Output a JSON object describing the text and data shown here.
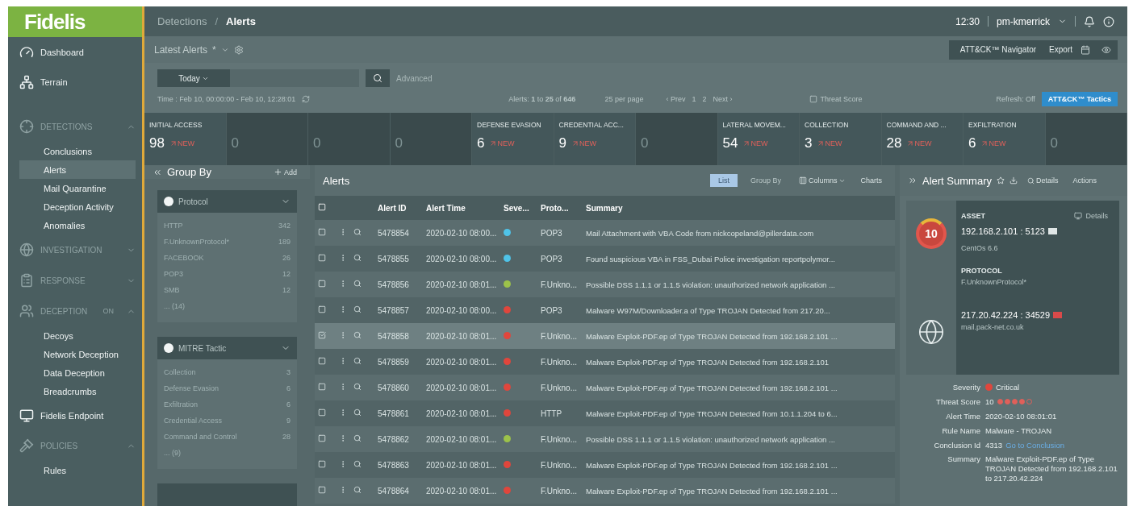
{
  "logo": "Fidelis",
  "nav": [
    {
      "kind": "link",
      "label": "Dashboard"
    },
    {
      "kind": "link",
      "label": "Terrain"
    },
    {
      "kind": "section",
      "label": "DETECTIONS",
      "expanded": true,
      "children": [
        {
          "label": "Conclusions",
          "selected": false
        },
        {
          "label": "Alerts",
          "selected": true
        },
        {
          "label": "Mail Quarantine",
          "selected": false
        },
        {
          "label": "Deception Activity",
          "selected": false
        },
        {
          "label": "Anomalies",
          "selected": false
        }
      ]
    },
    {
      "kind": "section",
      "label": "INVESTIGATION",
      "expanded": false
    },
    {
      "kind": "section",
      "label": "RESPONSE",
      "expanded": false
    },
    {
      "kind": "section",
      "label": "DECEPTION",
      "badge": "ON",
      "expanded": true,
      "children": [
        {
          "label": "Decoys",
          "selected": false
        },
        {
          "label": "Network Deception",
          "selected": false
        },
        {
          "label": "Data Deception",
          "selected": false
        },
        {
          "label": "Breadcrumbs",
          "selected": false
        }
      ]
    },
    {
      "kind": "link",
      "label": "Fidelis Endpoint"
    },
    {
      "kind": "section",
      "label": "POLICIES",
      "expanded": true,
      "children": [
        {
          "label": "Rules",
          "selected": false
        }
      ]
    }
  ],
  "breadcrumb": [
    "Detections",
    "Alerts"
  ],
  "breadcrumb_separator": "/",
  "clock": "12:30",
  "user": "pm-kmerrick",
  "view": {
    "title": "Latest Alerts",
    "modified": "*",
    "actions": [
      "ATT&CK™ Navigator",
      "Export"
    ]
  },
  "search": {
    "range": "Today",
    "advanced": "Advanced"
  },
  "time_range": "Time : Feb 10, 00:00:00 - Feb 10, 12:28:01",
  "count": "Alerts: **1** to **25** of **646**",
  "per_page": "25 per page",
  "pager": [
    "‹ Prev",
    "1",
    "2",
    "Next ›"
  ],
  "threat_score": {
    "label": "Threat Score",
    "checked": false
  },
  "refresh": "Refresh: Off",
  "tactics_button": "ATT&CK™ Tactics",
  "tiles": [
    {
      "label": "INITIAL ACCESS",
      "count": "98",
      "new": "NEW"
    },
    {
      "count": "0"
    },
    {
      "count": "0"
    },
    {
      "count": "0"
    },
    {
      "label": "DEFENSE EVASION",
      "count": "6",
      "new": "NEW"
    },
    {
      "label": "CREDENTIAL ACC...",
      "count": "9",
      "new": "NEW"
    },
    {
      "count": "0"
    },
    {
      "label": "LATERAL MOVEM...",
      "count": "54",
      "new": "NEW"
    },
    {
      "label": "COLLECTION",
      "count": "3",
      "new": "NEW"
    },
    {
      "label": "COMMAND AND ...",
      "count": "28",
      "new": "NEW"
    },
    {
      "label": "EXFILTRATION",
      "count": "6",
      "new": "NEW"
    },
    {
      "count": "0"
    }
  ],
  "group_by": {
    "title": "Group By",
    "add": "Add",
    "groups": [
      {
        "name": "Protocol",
        "expanded": true,
        "items": [
          {
            "label": "HTTP",
            "count": "342"
          },
          {
            "label": "F.UnknownProtocol*",
            "count": "189"
          },
          {
            "label": "FACEBOOK",
            "count": "26"
          },
          {
            "label": "POP3",
            "count": "12"
          },
          {
            "label": "SMB",
            "count": "12"
          }
        ],
        "more": "... (14)"
      },
      {
        "name": "MITRE Tactic",
        "expanded": true,
        "items": [
          {
            "label": "Collection",
            "count": "3"
          },
          {
            "label": "Defense Evasion",
            "count": "6"
          },
          {
            "label": "Exfiltration",
            "count": "6"
          },
          {
            "label": "Credential Access",
            "count": "9"
          },
          {
            "label": "Command and Control",
            "count": "28"
          }
        ],
        "more": "... (9)"
      }
    ]
  },
  "alerts": {
    "title": "Alerts",
    "views": [
      {
        "label": "List",
        "selected": true
      },
      {
        "label": "Group By",
        "selected": false
      }
    ],
    "columns_button": "Columns",
    "charts": "Charts",
    "all_selected": false,
    "columns": [
      "Alert ID",
      "Alert Time",
      "Seve...",
      "Proto...",
      "Summary"
    ],
    "rows": [
      {
        "id": "5478854",
        "time": "2020-02-10 08:00...",
        "color": "#4fc3e8",
        "protocol": "POP3",
        "summary": "Mail Attachment with VBA Code from nickcopeland@pillerdata.com",
        "selected": false
      },
      {
        "id": "5478855",
        "time": "2020-02-10 08:00...",
        "color": "#4fc3e8",
        "protocol": "POP3",
        "summary": "Found suspicious VBA in FSS_Dubai Police investigation reportpolymor...",
        "selected": false
      },
      {
        "id": "5478856",
        "time": "2020-02-10 08:01...",
        "color": "#9cc24a",
        "protocol": "F.Unkno...",
        "summary": "Possible DSS 1.1.1 or 1.1.5 violation: unauthorized network application ...",
        "selected": false
      },
      {
        "id": "5478857",
        "time": "2020-02-10 08:00...",
        "color": "#e0463c",
        "protocol": "POP3",
        "summary": "Malware W97M/Downloader.a of Type TROJAN Detected from 217.20...",
        "selected": false
      },
      {
        "id": "5478858",
        "time": "2020-02-10 08:01...",
        "color": "#e0463c",
        "protocol": "F.Unkno...",
        "summary": "Malware Exploit-PDF.ep of Type TROJAN Detected from 192.168.2.101 ...",
        "selected": true
      },
      {
        "id": "5478859",
        "time": "2020-02-10 08:01...",
        "color": "#e0463c",
        "protocol": "F.Unkno...",
        "summary": "Malware Exploit-PDF.ep of Type TROJAN Detected from 192.168.2.101",
        "selected": false
      },
      {
        "id": "5478860",
        "time": "2020-02-10 08:01...",
        "color": "#e0463c",
        "protocol": "F.Unkno...",
        "summary": "Malware Exploit-PDF.ep of Type TROJAN Detected from 192.168.2.101 ...",
        "selected": false
      },
      {
        "id": "5478861",
        "time": "2020-02-10 08:01...",
        "color": "#e0463c",
        "protocol": "HTTP",
        "summary": "Malware Exploit-PDF.ep of Type TROJAN Detected from 10.1.1.204 to 6...",
        "selected": false
      },
      {
        "id": "5478862",
        "time": "2020-02-10 08:01...",
        "color": "#9cc24a",
        "protocol": "F.Unkno...",
        "summary": "Possible DSS 1.1.1 or 1.1.5 violation: unauthorized network application ...",
        "selected": false
      },
      {
        "id": "5478863",
        "time": "2020-02-10 08:01...",
        "color": "#e0463c",
        "protocol": "F.Unkno...",
        "summary": "Malware Exploit-PDF.ep of Type TROJAN Detected from 192.168.2.101 ...",
        "selected": false
      },
      {
        "id": "5478864",
        "time": "2020-02-10 08:01...",
        "color": "#e0463c",
        "protocol": "F.Unkno...",
        "summary": "Malware Exploit-PDF.ep of Type TROJAN Detected from 192.168.2.101 ...",
        "selected": false
      }
    ]
  },
  "summary": {
    "title": "Alert Summary",
    "details": "Details",
    "actions": "Actions",
    "score": "10",
    "asset_label": "ASSET",
    "asset_details": "Details",
    "asset": "192.168.2.101 : 5123",
    "os": "CentOs 6.6",
    "protocol_label": "PROTOCOL",
    "protocol": "F.UnknownProtocol*",
    "remote": "217.20.42.224 : 34529",
    "remote_host": "mail.pack-net.co.uk",
    "fields": [
      {
        "kind": "severity",
        "label": "Severity",
        "value": "Critical",
        "color": "#e0463c"
      },
      {
        "kind": "score",
        "label": "Threat Score",
        "value": "10",
        "stars": 4
      },
      {
        "kind": "text",
        "label": "Alert Time",
        "value": "2020-02-10 08:01:01"
      },
      {
        "kind": "text",
        "label": "Rule Name",
        "value": "Malware - TROJAN"
      },
      {
        "kind": "link",
        "label": "Conclusion Id",
        "value": "4313",
        "link": "Go to Conclusion"
      },
      {
        "kind": "text",
        "label": "Summary",
        "value": "Malware Exploit-PDF.ep of Type TROJAN Detected from 192.168.2.101 to 217.20.42.224"
      }
    ]
  }
}
